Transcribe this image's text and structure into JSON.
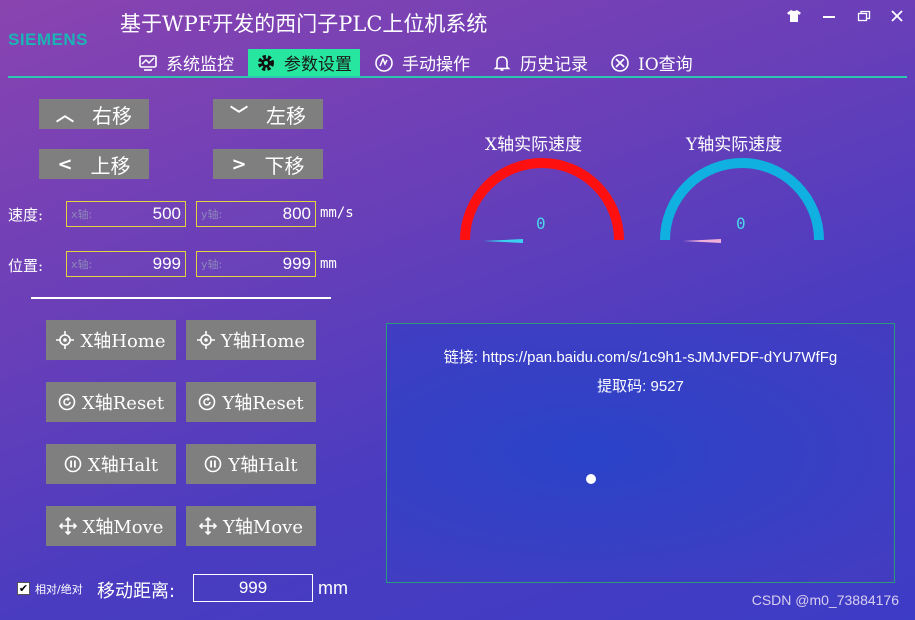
{
  "app": {
    "logo": "SIEMENS",
    "title": "基于WPF开发的西门子PLC上位机系统"
  },
  "nav": {
    "items": [
      {
        "label": "系统监控"
      },
      {
        "label": "参数设置"
      },
      {
        "label": "手动操作"
      },
      {
        "label": "历史记录"
      },
      {
        "label": "IO查询"
      }
    ],
    "active_index": 1
  },
  "move": {
    "right": "右移",
    "left": "左移",
    "up": "上移",
    "down": "下移"
  },
  "speed": {
    "label": "速度:",
    "x_placeholder": "x轴:",
    "x_value": "500",
    "y_placeholder": "y轴:",
    "y_value": "800",
    "unit": "mm/s"
  },
  "position": {
    "label": "位置:",
    "x_placeholder": "x轴:",
    "x_value": "999",
    "y_placeholder": "y轴:",
    "y_value": "999",
    "unit": "mm"
  },
  "axis_buttons": {
    "x_home": "X轴Home",
    "y_home": "Y轴Home",
    "x_reset": "X轴Reset",
    "y_reset": "Y轴Reset",
    "x_halt": "X轴Halt",
    "y_halt": "Y轴Halt",
    "x_move": "X轴Move",
    "y_move": "Y轴Move"
  },
  "bottom": {
    "mode_label": "相对/绝对",
    "mode_checked": true,
    "distance_label": "移动距离:",
    "distance_value": "999",
    "distance_unit": "mm"
  },
  "gauges": {
    "x": {
      "title": "X轴实际速度",
      "value": "0",
      "color": "#ff1010"
    },
    "y": {
      "title": "Y轴实际速度",
      "value": "0",
      "color": "#10b0e0"
    }
  },
  "info": {
    "link": "链接: https://pan.baidu.com/s/1c9h1-sJMJvFDF-dYU7WfFg",
    "code": "提取码: 9527"
  },
  "watermark": "CSDN @m0_73884176",
  "colors": {
    "accent": "#27e7a0",
    "button_gray": "#7f7f7f",
    "field_border": "#e6d23a"
  }
}
